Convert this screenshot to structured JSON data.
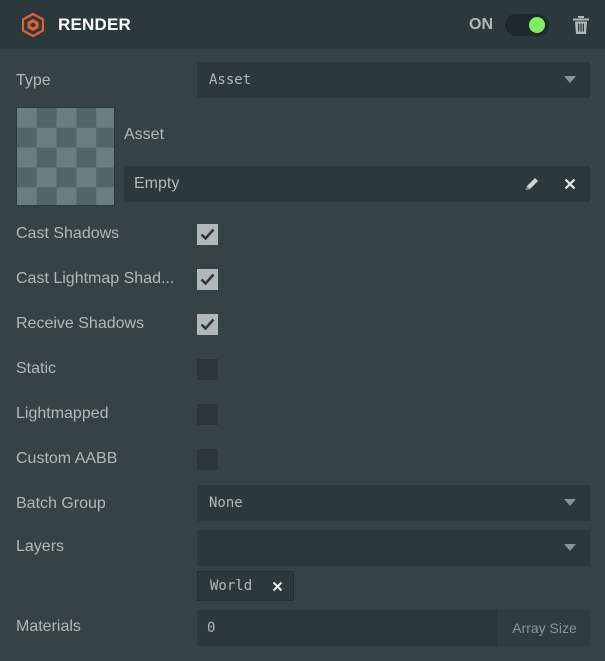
{
  "header": {
    "title": "RENDER",
    "toggle_label": "ON",
    "icon": "render-component-icon",
    "delete_icon": "trash-icon",
    "accent": "#e2622b",
    "toggle_color": "#7ef060"
  },
  "type": {
    "label": "Type",
    "value": "Asset"
  },
  "asset": {
    "label": "Asset",
    "value": "Empty",
    "edit_icon": "pencil-icon",
    "clear_icon": "close-icon"
  },
  "checkboxes": [
    {
      "label": "Cast Shadows",
      "checked": true
    },
    {
      "label": "Cast Lightmap Shad...",
      "checked": true
    },
    {
      "label": "Receive Shadows",
      "checked": true
    },
    {
      "label": "Static",
      "checked": false
    },
    {
      "label": "Lightmapped",
      "checked": false
    },
    {
      "label": "Custom AABB",
      "checked": false
    }
  ],
  "batch_group": {
    "label": "Batch Group",
    "value": "None"
  },
  "layers": {
    "label": "Layers",
    "value": "",
    "tags": [
      "World"
    ]
  },
  "materials": {
    "label": "Materials",
    "value": "0",
    "button": "Array Size"
  }
}
